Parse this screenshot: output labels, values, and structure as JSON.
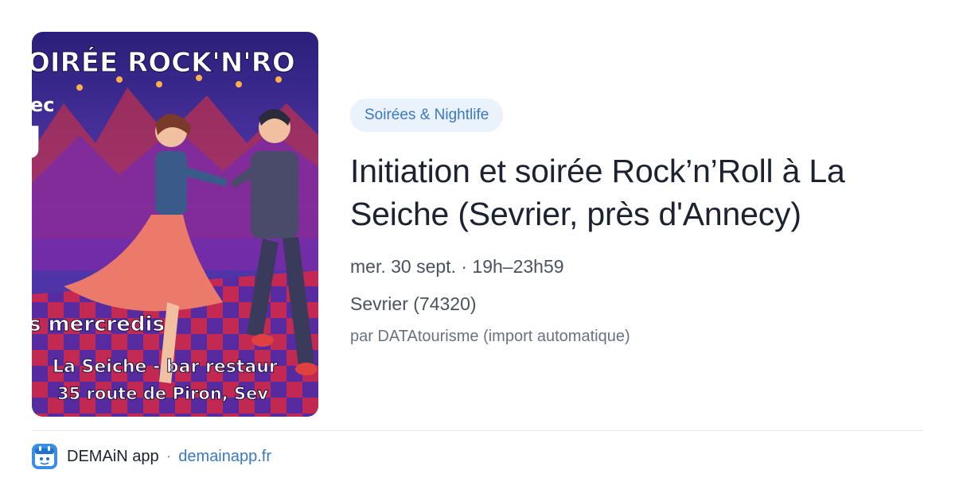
{
  "poster": {
    "title": "OIRÉE ROCK'N'RO",
    "line_a": "ec",
    "line_b": "J",
    "days": "s mercredis",
    "venue": "La Seiche - bar restaur",
    "address": "35 route de Piron, Sev"
  },
  "event": {
    "category": "Soirées & Nightlife",
    "title": "Initiation et soirée Rock’n’Roll à La Seiche (Sevrier, près d'Annecy)",
    "datetime": "mer. 30 sept. · 19h–23h59",
    "location": "Sevrier (74320)",
    "source": "par DATAtourisme (import automatique)"
  },
  "footer": {
    "app_name": "DEMAiN app",
    "separator": "·",
    "link": "demainapp.fr"
  }
}
